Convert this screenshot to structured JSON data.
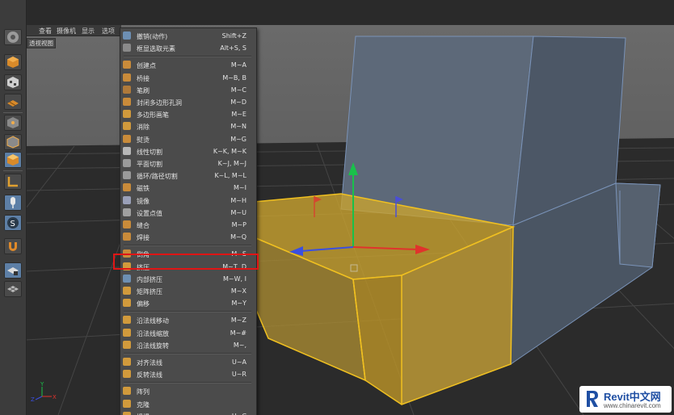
{
  "viewport": {
    "menus": [
      "查看",
      "摄像机",
      "显示",
      "选项"
    ],
    "label": "透视视图",
    "axis_labels": {
      "y": "Y",
      "z": "Z",
      "x": "X"
    }
  },
  "toolbar": {
    "icons": [
      "cinema4d-logo-icon",
      "model-mode-icon",
      "texture-mode-icon",
      "workplane-mode-icon",
      "points-mode-icon",
      "edges-mode-icon",
      "polygons-mode-icon",
      "axis-mode-icon",
      "tweak-mode-icon",
      "snap-icon",
      "magnet-icon",
      "workplane-lock-icon",
      "grid-icon"
    ]
  },
  "context_menu": {
    "items": [
      {
        "label": "撤销(动作)",
        "shortcut": "Shift+Z",
        "icon": "undo-icon",
        "color": "#6d8fb3"
      },
      {
        "label": "框显选取元素",
        "shortcut": "Alt+S, S",
        "icon": "frame-selection-icon",
        "color": "#8a8a8a"
      },
      {
        "separator": true
      },
      {
        "label": "创建点",
        "shortcut": "M~A",
        "icon": "create-point-icon",
        "color": "#c98b3a"
      },
      {
        "label": "桥接",
        "shortcut": "M~B, B",
        "icon": "bridge-icon",
        "color": "#c98b3a"
      },
      {
        "label": "笔刷",
        "shortcut": "M~C",
        "icon": "brush-icon",
        "color": "#b07a3a"
      },
      {
        "label": "封闭多边形孔洞",
        "shortcut": "M~D",
        "icon": "close-polygon-hole-icon",
        "color": "#c98b3a"
      },
      {
        "label": "多边形画笔",
        "shortcut": "M~E",
        "icon": "polygon-pen-icon",
        "color": "#d19a3c"
      },
      {
        "label": "消除",
        "shortcut": "M~N",
        "icon": "dissolve-icon",
        "color": "#d19a3c"
      },
      {
        "label": "熨烫",
        "shortcut": "M~G",
        "icon": "iron-icon",
        "color": "#c98b3a"
      },
      {
        "label": "线性切割",
        "shortcut": "K~K, M~K",
        "icon": "line-cut-icon",
        "color": "#b8b8b8"
      },
      {
        "label": "平面切割",
        "shortcut": "K~J, M~J",
        "icon": "plane-cut-icon",
        "color": "#9a9a9a"
      },
      {
        "label": "循环/路径切割",
        "shortcut": "K~L, M~L",
        "icon": "loop-cut-icon",
        "color": "#9a9a9a"
      },
      {
        "label": "磁铁",
        "shortcut": "M~I",
        "icon": "magnet-tool-icon",
        "color": "#c98b3a"
      },
      {
        "label": "镜像",
        "shortcut": "M~H",
        "icon": "mirror-icon",
        "color": "#9aa0b8"
      },
      {
        "label": "设置点值",
        "shortcut": "M~U",
        "icon": "set-point-value-icon",
        "color": "#a0a0a0"
      },
      {
        "label": "缝合",
        "shortcut": "M~P",
        "icon": "stitch-icon",
        "color": "#c98b3a"
      },
      {
        "label": "焊接",
        "shortcut": "M~Q",
        "icon": "weld-icon",
        "color": "#c98b3a"
      },
      {
        "separator": true
      },
      {
        "label": "倒角",
        "shortcut": "M~S",
        "icon": "bevel-icon",
        "color": "#c98b3a"
      },
      {
        "label": "挤压",
        "shortcut": "M~T, D",
        "icon": "extrude-icon",
        "color": "#d19a3c"
      },
      {
        "label": "内部挤压",
        "shortcut": "M~W, I",
        "icon": "extrude-inner-icon",
        "color": "#6d8fb3"
      },
      {
        "label": "矩阵挤压",
        "shortcut": "M~X",
        "icon": "matrix-extrude-icon",
        "color": "#d19a3c"
      },
      {
        "label": "偏移",
        "shortcut": "M~Y",
        "icon": "smooth-shift-icon",
        "color": "#d19a3c"
      },
      {
        "separator": true
      },
      {
        "label": "沿法线移动",
        "shortcut": "M~Z",
        "icon": "normal-move-icon",
        "color": "#d19a3c"
      },
      {
        "label": "沿法线缩放",
        "shortcut": "M~#",
        "icon": "normal-scale-icon",
        "color": "#d19a3c"
      },
      {
        "label": "沿法线旋转",
        "shortcut": "M~,",
        "icon": "normal-rotate-icon",
        "color": "#d19a3c"
      },
      {
        "separator": true
      },
      {
        "label": "对齐法线",
        "shortcut": "U~A",
        "icon": "align-normals-icon",
        "color": "#d19a3c"
      },
      {
        "label": "反转法线",
        "shortcut": "U~R",
        "icon": "reverse-normals-icon",
        "color": "#d19a3c"
      },
      {
        "separator": true
      },
      {
        "label": "阵列",
        "shortcut": "",
        "icon": "array-icon",
        "color": "#d19a3c"
      },
      {
        "label": "克隆",
        "shortcut": "",
        "icon": "clone-icon",
        "color": "#d19a3c"
      },
      {
        "label": "坍塌",
        "shortcut": "U~C",
        "icon": "collapse-icon",
        "color": "#d19a3c"
      }
    ],
    "highlighted": "挤压"
  },
  "watermark": {
    "title": "Revit中文网",
    "url": "www.chinarevit.com"
  }
}
